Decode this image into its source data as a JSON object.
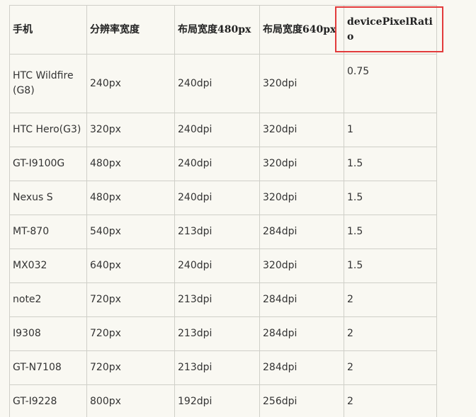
{
  "table": {
    "headers": [
      "手机",
      "分辨率宽度",
      "布局宽度480px",
      "布局宽度640px",
      "devicePixelRatio"
    ],
    "rows": [
      [
        "HTC Wildfire (G8)",
        "240px",
        "240dpi",
        "320dpi",
        "0.75"
      ],
      [
        "HTC Hero(G3)",
        "320px",
        "240dpi",
        "320dpi",
        "1"
      ],
      [
        "GT-I9100G",
        "480px",
        "240dpi",
        "320dpi",
        "1.5"
      ],
      [
        "Nexus S",
        "480px",
        "240dpi",
        "320dpi",
        "1.5"
      ],
      [
        "MT-870",
        "540px",
        "213dpi",
        "284dpi",
        "1.5"
      ],
      [
        "MX032",
        "640px",
        "240dpi",
        "320dpi",
        "1.5"
      ],
      [
        "note2",
        "720px",
        "213dpi",
        "284dpi",
        "2"
      ],
      [
        "I9308",
        "720px",
        "213dpi",
        "284dpi",
        "2"
      ],
      [
        "GT-N7108",
        "720px",
        "213dpi",
        "284dpi",
        "2"
      ],
      [
        "GT-I9228",
        "800px",
        "192dpi",
        "256dpi",
        "2"
      ]
    ]
  },
  "highlight": {
    "color": "#e23b3b"
  }
}
